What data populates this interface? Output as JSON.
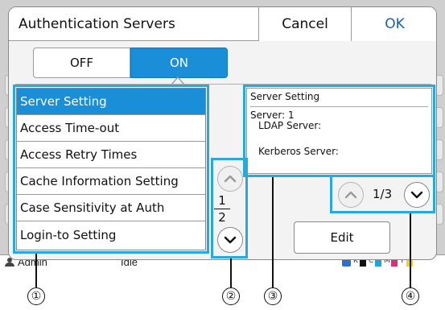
{
  "dialog": {
    "title": "Authentication Servers",
    "cancel_label": "Cancel",
    "ok_label": "OK"
  },
  "toggle": {
    "off_label": "OFF",
    "on_label": "ON",
    "selected": "ON"
  },
  "menu": {
    "items": [
      {
        "label": "Server Setting",
        "selected": true
      },
      {
        "label": "Access Time-out",
        "selected": false
      },
      {
        "label": "Access Retry Times",
        "selected": false
      },
      {
        "label": "Cache Information Setting",
        "selected": false
      },
      {
        "label": "Case Sensitivity at Auth",
        "selected": false
      },
      {
        "label": "Login-to Setting",
        "selected": false
      }
    ],
    "page_current": "1",
    "page_total": "2"
  },
  "info": {
    "title": "Server Setting",
    "server_line": "Server: 1",
    "ldap_line": "LDAP Server:",
    "kerberos_line": "Kerberos Server:"
  },
  "pager": {
    "text": "1/3"
  },
  "edit_label": "Edit",
  "background": {
    "user_text": "Admin",
    "status_text": "Idle"
  },
  "callouts": [
    "①",
    "②",
    "③",
    "④"
  ],
  "colors": {
    "accent": "#1b8ed8",
    "ok_text": "#1a5fb4",
    "highlight": "#29a8e0"
  }
}
